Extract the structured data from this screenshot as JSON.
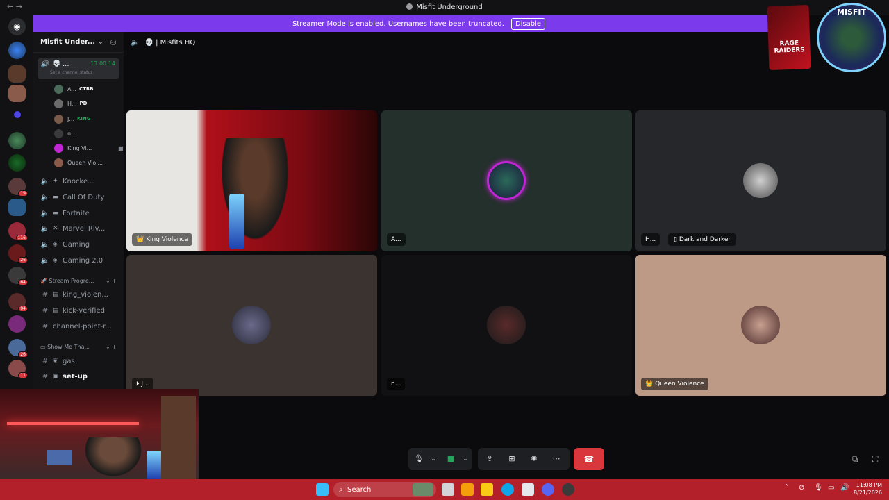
{
  "window": {
    "title": "Misfit Underground",
    "back": "←",
    "forward": "→"
  },
  "banner": {
    "text": "Streamer Mode is enabled. Usernames have been truncated.",
    "button": "Disable"
  },
  "server": {
    "name": "Misfit Under...",
    "invite_icon": "add-person-icon"
  },
  "voice_channel": {
    "name": "Misfits HQ",
    "short": "...",
    "timer": "13:00:14",
    "status_placeholder": "Set a channel status"
  },
  "voice_users": [
    {
      "name": "A...",
      "tag": "CTRB"
    },
    {
      "name": "H...",
      "tag": "PD"
    },
    {
      "name": "J...",
      "tag": "KING"
    },
    {
      "name": "n..."
    },
    {
      "name": "King Vi..."
    },
    {
      "name": "Queen Viol..."
    }
  ],
  "channels": [
    {
      "name": "Knocke...",
      "type": "voice"
    },
    {
      "name": "Call Of Duty",
      "type": "voice"
    },
    {
      "name": "Fortnite",
      "type": "voice"
    },
    {
      "name": "Marvel Riv...",
      "type": "voice"
    },
    {
      "name": "Gaming",
      "type": "voice"
    },
    {
      "name": "Gaming 2.0",
      "type": "voice"
    }
  ],
  "categories": [
    {
      "name": "Stream Progre..."
    },
    {
      "name": "Show Me Tha..."
    }
  ],
  "text_channels_1": [
    {
      "name": "king_violen..."
    },
    {
      "name": "kick-verified"
    },
    {
      "name": "channel-point-r..."
    }
  ],
  "text_channels_2": [
    {
      "name": "gas"
    },
    {
      "name": "set-up"
    }
  ],
  "tiles": [
    {
      "label": "King Violence"
    },
    {
      "label": "A..."
    },
    {
      "label": "H...",
      "activity": "Dark and Darker"
    },
    {
      "label": "J..."
    },
    {
      "label": "n..."
    },
    {
      "label": "Queen Violence"
    }
  ],
  "overlay": {
    "rage_text": "RAGE RAIDERS",
    "misfit_text": "MISFIT"
  },
  "taskbar": {
    "search": "Search",
    "time": "11:08 PM",
    "date": "8/21/2026"
  },
  "server_badges": [
    "19",
    "116",
    "26",
    "64",
    "94",
    "26",
    "11"
  ],
  "colors": {
    "banner": "#7c3aed",
    "hangup": "#da373c",
    "taskbar": "#b3202a"
  }
}
